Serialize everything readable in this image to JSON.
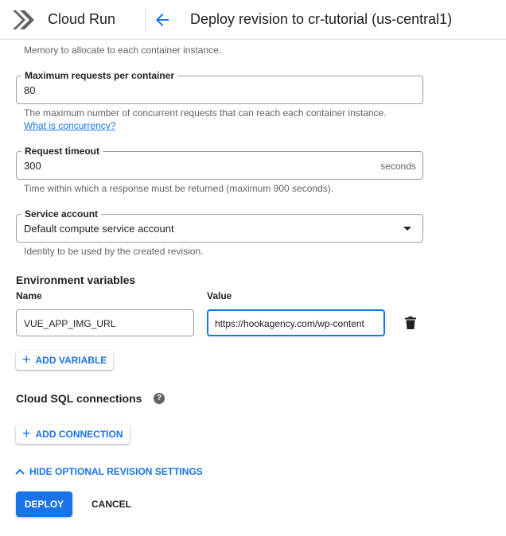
{
  "header": {
    "product_name": "Cloud Run",
    "page_title": "Deploy revision to cr-tutorial (us-central1)"
  },
  "memory": {
    "helper": "Memory to allocate to each container instance."
  },
  "max_requests": {
    "label": "Maximum requests per container",
    "value": "80",
    "helper": "The maximum number of concurrent requests that can reach each container instance.",
    "link": "What is concurrency?"
  },
  "request_timeout": {
    "label": "Request timeout",
    "value": "300",
    "suffix": "seconds",
    "helper": "Time within which a response must be returned (maximum 900 seconds)."
  },
  "service_account": {
    "label": "Service account",
    "value": "Default compute service account",
    "helper": "Identity to be used by the created revision."
  },
  "env_vars": {
    "title": "Environment variables",
    "name_label": "Name",
    "value_label": "Value",
    "rows": [
      {
        "name": "VUE_APP_IMG_URL",
        "value": "https://hookagency.com/wp-content"
      }
    ],
    "add_label": "ADD VARIABLE"
  },
  "cloud_sql": {
    "title": "Cloud SQL connections",
    "help_icon": "?",
    "add_label": "ADD CONNECTION"
  },
  "toggle_label": "HIDE OPTIONAL REVISION SETTINGS",
  "actions": {
    "deploy": "DEPLOY",
    "cancel": "CANCEL"
  },
  "colors": {
    "accent": "#1a73e8",
    "text": "#202124",
    "secondary_text": "#5f6368",
    "border": "#9aa0a6"
  }
}
